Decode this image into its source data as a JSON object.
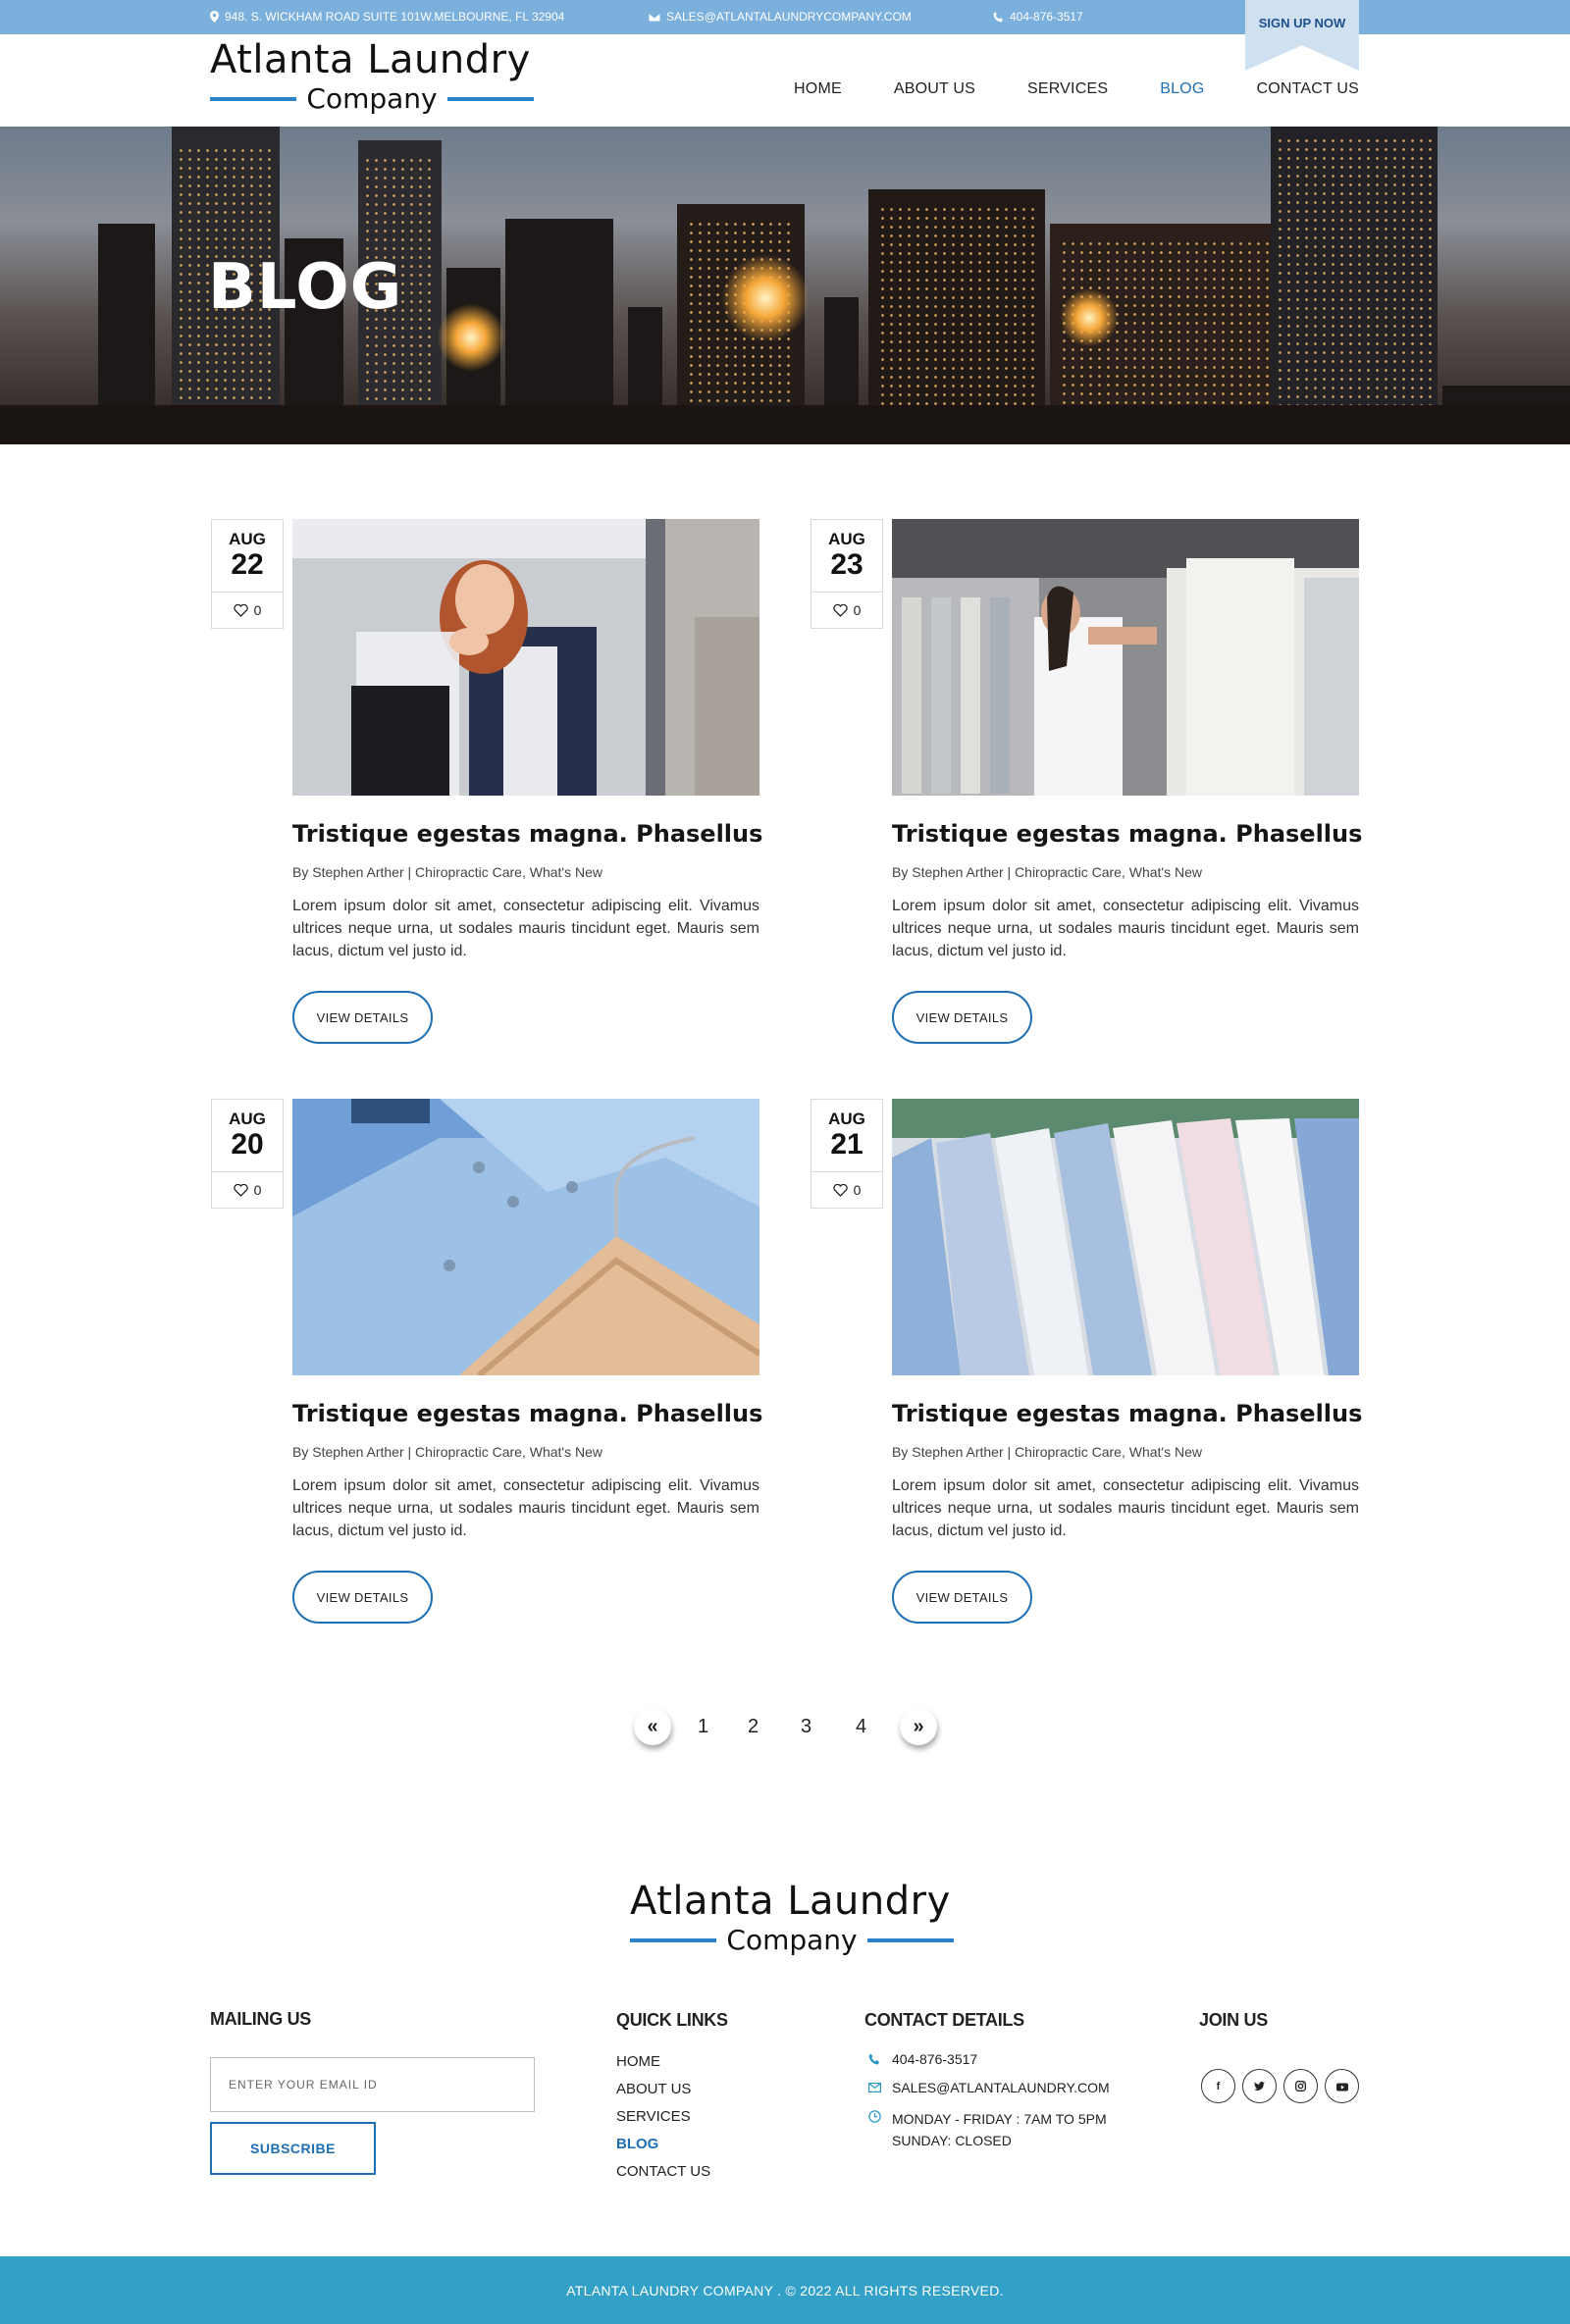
{
  "topbar": {
    "address": "948. S. WICKHAM ROAD SUITE 101W.MELBOURNE, FL 32904",
    "email": "SALES@ATLANTALAUNDRYCOMPANY.COM",
    "phone": "404-876-3517",
    "signup": "SIGN UP NOW"
  },
  "brand": {
    "line1": "Atlanta Laundry",
    "line2": "Company",
    "accent": "#2c82c9"
  },
  "nav": {
    "items": [
      {
        "label": "HOME"
      },
      {
        "label": "ABOUT US"
      },
      {
        "label": "SERVICES"
      },
      {
        "label": "BLOG",
        "active": true
      },
      {
        "label": "CONTACT US"
      }
    ]
  },
  "hero": {
    "title": "BLOG"
  },
  "posts": [
    {
      "month": "AUG",
      "day": "22",
      "likes": "0",
      "title": "Tristique egestas magna. Phasellus",
      "meta": "By Stephen Arther | Chiropractic Care, What's New",
      "excerpt": "Lorem ipsum dolor sit amet, consectetur adipiscing elit. Vivamus ultrices neque urna, ut sodales mauris tincidunt eget. Mauris sem lacus, dictum vel justo id.",
      "button": "VIEW DETAILS",
      "image_icon": "woman-holding-dry-cleaning-photo"
    },
    {
      "month": "AUG",
      "day": "23",
      "likes": "0",
      "title": "Tristique egestas magna. Phasellus",
      "meta": "By Stephen Arther | Chiropractic Care, What's New",
      "excerpt": "Lorem ipsum dolor sit amet, consectetur adipiscing elit. Vivamus ultrices neque urna, ut sodales mauris tincidunt eget. Mauris sem lacus, dictum vel justo id.",
      "button": "VIEW DETAILS",
      "image_icon": "woman-at-garment-rack-photo"
    },
    {
      "month": "AUG",
      "day": "20",
      "likes": "0",
      "title": "Tristique egestas magna. Phasellus",
      "meta": "By Stephen Arther | Chiropractic Care, What's New",
      "excerpt": "Lorem ipsum dolor sit amet, consectetur adipiscing elit. Vivamus ultrices neque urna, ut sodales mauris tincidunt eget. Mauris sem lacus, dictum vel justo id.",
      "button": "VIEW DETAILS",
      "image_icon": "blue-shirt-hanger-photo"
    },
    {
      "month": "AUG",
      "day": "21",
      "likes": "0",
      "title": "Tristique egestas magna. Phasellus",
      "meta": "By Stephen Arther | Chiropractic Care, What's New",
      "excerpt": "Lorem ipsum dolor sit amet, consectetur adipiscing elit. Vivamus ultrices neque urna, ut sodales mauris tincidunt eget. Mauris sem lacus, dictum vel justo id.",
      "button": "VIEW DETAILS",
      "image_icon": "shirts-on-rack-photo"
    }
  ],
  "pagination": {
    "prev": "«",
    "pages": [
      "1",
      "2",
      "3",
      "4"
    ],
    "next": "»"
  },
  "footer": {
    "mailing": {
      "heading": "MAILING US",
      "placeholder": "ENTER YOUR EMAIL ID",
      "button": "SUBSCRIBE"
    },
    "quick_links": {
      "heading": "QUICK LINKS",
      "items": [
        "HOME",
        "ABOUT US",
        "SERVICES",
        "BLOG",
        "CONTACT US"
      ]
    },
    "contact": {
      "heading": "CONTACT DETAILS",
      "phone": "404-876-3517",
      "email": "SALES@ATLANTALAUNDRY.COM",
      "hours_line1": "MONDAY - FRIDAY : 7AM TO 5PM",
      "hours_line2": "SUNDAY: CLOSED"
    },
    "join": {
      "heading": "JOIN US",
      "icons": [
        "facebook-icon",
        "twitter-icon",
        "instagram-icon",
        "youtube-icon"
      ]
    },
    "copyright": "ATLANTA LAUNDRY COMPANY .  © 2022 ALL RIGHTS RESERVED."
  },
  "colors": {
    "topbar": "#7bafdc",
    "link_active": "#1f6fb5",
    "footer_bar": "#33a0c8"
  }
}
